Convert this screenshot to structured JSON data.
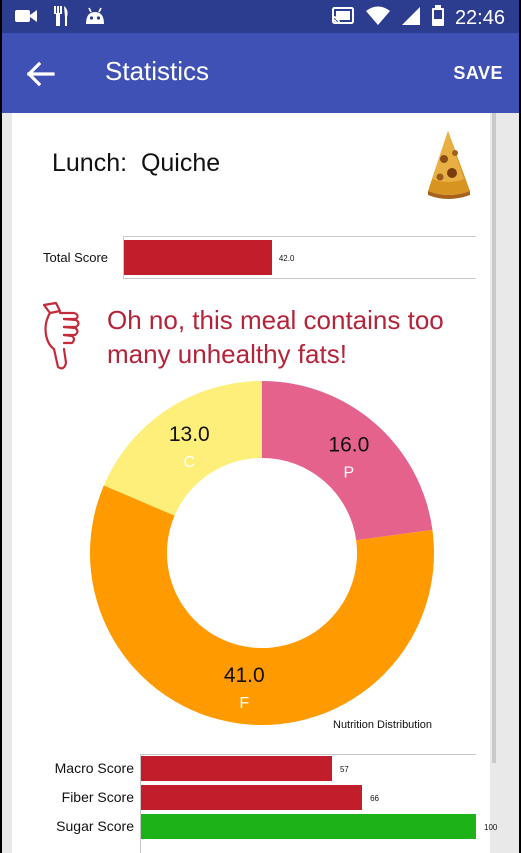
{
  "status_bar": {
    "time": "22:46",
    "left_icons": [
      "video-camera-icon",
      "fork-knife-icon",
      "android-icon"
    ],
    "right_icons": [
      "cast-icon",
      "wifi-icon",
      "signal-icon",
      "battery-icon"
    ]
  },
  "app_bar": {
    "title": "Statistics",
    "save_label": "SAVE",
    "color": "#3f51b5",
    "status_color": "#2c3d8f"
  },
  "meal": {
    "title": "Lunch:  Quiche"
  },
  "total_score": {
    "label": "Total Score",
    "value": 42.0,
    "value_text": "42.0",
    "max": 100,
    "color": "#c11d2b"
  },
  "message": {
    "text": "Oh no, this meal contains too many unhealthy fats!",
    "color": "#b3233a"
  },
  "chart_data": {
    "type": "pie",
    "label": "Nutrition Distribution",
    "slices": [
      {
        "value": 16.0,
        "value_text": "16.0",
        "label": "P",
        "color": "#e5628c"
      },
      {
        "value": 41.0,
        "value_text": "41.0",
        "label": "F",
        "color": "#ff9a00"
      },
      {
        "value": 13.0,
        "value_text": "13.0",
        "label": "C",
        "color": "#fdef7a"
      }
    ]
  },
  "scores": [
    {
      "label": "Macro Score",
      "value": 57,
      "value_text": "57",
      "color": "#c11d2b"
    },
    {
      "label": "Fiber Score",
      "value": 66,
      "value_text": "66",
      "color": "#c11d2b"
    },
    {
      "label": "Sugar Score",
      "value": 100,
      "value_text": "100",
      "color": "#1db217"
    }
  ]
}
